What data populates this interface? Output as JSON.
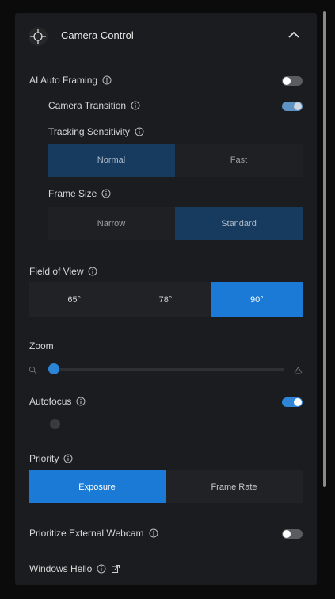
{
  "header": {
    "title": "Camera Control",
    "icon": "crosshair-icon",
    "collapse_icon": "chevron-up-icon"
  },
  "ai_auto_framing": {
    "label": "AI Auto Framing",
    "enabled": false
  },
  "camera_transition": {
    "label": "Camera Transition",
    "enabled": true
  },
  "tracking_sensitivity": {
    "label": "Tracking Sensitivity",
    "options": [
      "Normal",
      "Fast"
    ],
    "selected": "Normal"
  },
  "frame_size": {
    "label": "Frame Size",
    "options": [
      "Narrow",
      "Standard"
    ],
    "selected": "Standard"
  },
  "field_of_view": {
    "label": "Field of View",
    "options": [
      "65°",
      "78°",
      "90°"
    ],
    "selected": "90°"
  },
  "zoom": {
    "label": "Zoom",
    "value_fraction": 0.0
  },
  "autofocus": {
    "label": "Autofocus",
    "enabled": true
  },
  "priority": {
    "label": "Priority",
    "options": [
      "Exposure",
      "Frame Rate"
    ],
    "selected": "Exposure"
  },
  "prioritize_external_webcam": {
    "label": "Prioritize External Webcam",
    "enabled": false
  },
  "windows_hello": {
    "label": "Windows Hello",
    "link_icon": "external-link-icon"
  },
  "colors": {
    "accent": "#1a7ad6",
    "panel": "#1b1c1f",
    "selected_dark": "#163b5e"
  }
}
